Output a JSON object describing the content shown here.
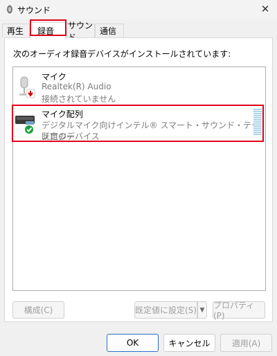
{
  "window": {
    "title": "サウンド",
    "close_label": "✕"
  },
  "tabs": [
    {
      "label": "再生",
      "selected": false
    },
    {
      "label": "録音",
      "selected": true
    },
    {
      "label": "サウンド",
      "selected": false
    },
    {
      "label": "通信",
      "selected": false
    }
  ],
  "panel": {
    "instruction": "次のオーディオ録音デバイスがインストールされています:",
    "devices": [
      {
        "name": "マイク",
        "driver": "Realtek(R) Audio",
        "status": "接続されていません",
        "icon": "microphone-icon",
        "badge": "disconnected-arrow-icon"
      },
      {
        "name": "マイク配列",
        "driver": "デジタルマイク向けインテル® スマート・サウンド・テクノロジー",
        "status": "既定のデバイス",
        "icon": "mic-array-icon",
        "badge": "default-check-icon"
      }
    ]
  },
  "buttons": {
    "configure": "構成(C)",
    "set_default": "既定値に設定(S)",
    "properties": "プロパティ(P)",
    "ok": "OK",
    "cancel": "キャンセル",
    "apply": "適用(A)"
  },
  "colors": {
    "highlight": "#e0001b",
    "level_meter": "#a9d3e6",
    "default_check": "#1e9e3e",
    "disconnected_badge": "#d40000",
    "ok_border": "#2b6cc9"
  }
}
